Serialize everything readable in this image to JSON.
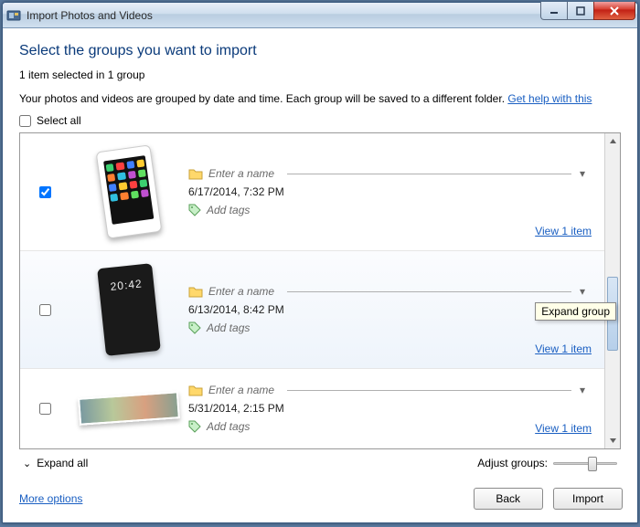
{
  "window": {
    "title": "Import Photos and Videos"
  },
  "header": {
    "heading": "Select the groups you want to import",
    "status": "1 item selected in 1 group",
    "description_prefix": "Your photos and videos are grouped by date and time. Each group will be saved to a different folder. ",
    "help_link": "Get help with this"
  },
  "select_all_label": "Select all",
  "groups": [
    {
      "name_placeholder": "Enter a name",
      "date": "6/17/2014, 7:32 PM",
      "tags_placeholder": "Add tags",
      "view_link": "View 1 item",
      "checked": true
    },
    {
      "name_placeholder": "Enter a name",
      "date": "6/13/2014, 8:42 PM",
      "tags_placeholder": "Add tags",
      "view_link": "View 1 item",
      "checked": false
    },
    {
      "name_placeholder": "Enter a name",
      "date": "5/31/2014, 2:15 PM",
      "tags_placeholder": "Add tags",
      "view_link": "View 1 item",
      "checked": false
    }
  ],
  "tooltip": "Expand group",
  "footer": {
    "expand_all": "Expand all",
    "adjust_label": "Adjust groups:",
    "more_options": "More options",
    "back": "Back",
    "import": "Import"
  }
}
